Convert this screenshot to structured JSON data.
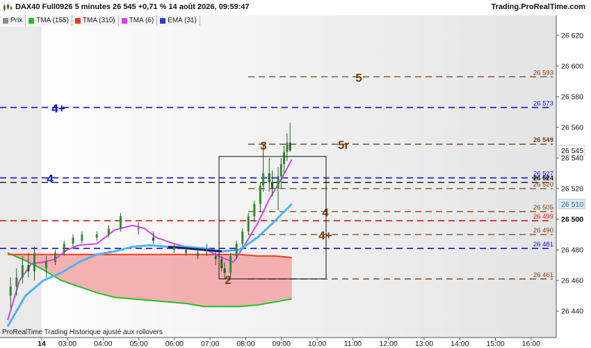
{
  "header": {
    "title": "DAX40 Full0926 5 minutes 26 545 +0,71 % 14 août 2026, 09:59:47",
    "brand": "Trading.ProRealTime.com"
  },
  "legend": [
    {
      "label": "Prix",
      "color": "#8e8e8e"
    },
    {
      "label": "TMA (155)",
      "color": "#22c022"
    },
    {
      "label": "TMA (310)",
      "color": "#ee3a1e"
    },
    {
      "label": "TMA (6)",
      "color": "#cc44ee"
    },
    {
      "label": "EMA (31)",
      "color": "#2244cc"
    }
  ],
  "footer": {
    "note": "ProRealTime Trading  Historique ajusté aux rollovers"
  },
  "chart_data": {
    "type": "line",
    "title": "DAX40 Full0926 5 minutes",
    "x_ticks": [
      "14",
      "03:00",
      "04:00",
      "05:00",
      "06:00",
      "07:00",
      "08:00",
      "09:00",
      "10:00",
      "11:00",
      "12:00",
      "13:00",
      "14:00",
      "15:00",
      "16:00"
    ],
    "y_ticks": [
      26440,
      26460,
      26480,
      26500,
      26520,
      26540,
      26560,
      26580,
      26600,
      26620
    ],
    "y_tick_labels": [
      "26 440",
      "26 460",
      "26 480",
      "26 500",
      "26 520",
      "26 540",
      "26 560",
      "26 580",
      "26 600",
      "26 620"
    ],
    "ylim": [
      26430,
      26627
    ],
    "xlim": [
      "02:00",
      "16:35"
    ],
    "grid": false,
    "levels": [
      {
        "value": 26593,
        "label": "26 593",
        "tag": "5",
        "color": "#7a3e0e"
      },
      {
        "value": 26573,
        "label": "26 573",
        "tag": "4+",
        "color": "#0f0fd0"
      },
      {
        "value": 26549,
        "label": "26 549",
        "tag": "5r",
        "color": "#7a3e0e"
      },
      {
        "value": 26527,
        "label": "26 527",
        "tag": "4",
        "color": "#0f0fd0"
      },
      {
        "value": 26524,
        "label": "26 524",
        "tag": "",
        "color": "#111111"
      },
      {
        "value": 26520,
        "label": "26 520",
        "tag": "",
        "color": "#7a3e0e"
      },
      {
        "value": 26505,
        "label": "26 505",
        "tag": "4",
        "color": "#7a3e0e"
      },
      {
        "value": 26499,
        "label": "26 499",
        "tag": "",
        "color": "#e01010"
      },
      {
        "value": 26490,
        "label": "26 490",
        "tag": "4+",
        "color": "#7a3e0e"
      },
      {
        "value": 26481,
        "label": "26 481",
        "tag": "",
        "color": "#0f0fd0"
      },
      {
        "value": 26461,
        "label": "26 461",
        "tag": "2",
        "color": "#7a3e0e"
      }
    ],
    "box_label_3": "3",
    "last_price": {
      "value": 26545,
      "label": "26 545"
    },
    "ema_last": {
      "value": 26510,
      "label": "26 510"
    },
    "bold_tick": {
      "value": 26500,
      "label": "26 500"
    },
    "series": [
      {
        "name": "TMA (155)",
        "color": "#22c022",
        "points": [
          [
            "02:00",
            26478
          ],
          [
            "02:30",
            26473
          ],
          [
            "03:00",
            26467
          ],
          [
            "03:30",
            26460
          ],
          [
            "04:00",
            26456
          ],
          [
            "04:30",
            26452
          ],
          [
            "05:00",
            26449
          ],
          [
            "05:30",
            26448
          ],
          [
            "06:00",
            26447
          ],
          [
            "06:30",
            26446
          ],
          [
            "07:00",
            26445
          ],
          [
            "07:30",
            26443
          ],
          [
            "08:00",
            26443
          ],
          [
            "08:30",
            26443
          ],
          [
            "09:00",
            26444
          ],
          [
            "09:30",
            26446
          ],
          [
            "09:58",
            26448
          ]
        ]
      },
      {
        "name": "TMA (310)",
        "color": "#ee3a1e",
        "points": [
          [
            "02:00",
            26477
          ],
          [
            "03:00",
            26477
          ],
          [
            "04:00",
            26477
          ],
          [
            "05:00",
            26477
          ],
          [
            "06:00",
            26477
          ],
          [
            "07:00",
            26477
          ],
          [
            "07:30",
            26477
          ],
          [
            "08:00",
            26477
          ],
          [
            "08:30",
            26477
          ],
          [
            "09:00",
            26476
          ],
          [
            "09:30",
            26476
          ],
          [
            "09:58",
            26475
          ]
        ]
      },
      {
        "name": "TMA (6)",
        "color": "#cc44ee",
        "points": [
          [
            "02:00",
            26434
          ],
          [
            "02:20",
            26460
          ],
          [
            "02:40",
            26471
          ],
          [
            "03:00",
            26472
          ],
          [
            "03:20",
            26474
          ],
          [
            "03:40",
            26480
          ],
          [
            "04:00",
            26483
          ],
          [
            "04:30",
            26484
          ],
          [
            "05:00",
            26493
          ],
          [
            "05:30",
            26496
          ],
          [
            "05:50",
            26494
          ],
          [
            "06:10",
            26488
          ],
          [
            "06:40",
            26484
          ],
          [
            "07:00",
            26482
          ],
          [
            "07:20",
            26481
          ],
          [
            "07:40",
            26479
          ],
          [
            "08:00",
            26475
          ],
          [
            "08:20",
            26472
          ],
          [
            "08:40",
            26484
          ],
          [
            "09:00",
            26497
          ],
          [
            "09:20",
            26513
          ],
          [
            "09:40",
            26526
          ],
          [
            "09:58",
            26539
          ]
        ]
      },
      {
        "name": "EMA (31)",
        "color": "#4fb3f0",
        "points": [
          [
            "02:00",
            26430
          ],
          [
            "02:30",
            26450
          ],
          [
            "03:00",
            26460
          ],
          [
            "03:30",
            26465
          ],
          [
            "04:00",
            26472
          ],
          [
            "04:30",
            26477
          ],
          [
            "05:00",
            26479
          ],
          [
            "05:30",
            26482
          ],
          [
            "06:00",
            26483
          ],
          [
            "06:30",
            26482
          ],
          [
            "07:00",
            26482
          ],
          [
            "07:30",
            26481
          ],
          [
            "08:00",
            26479
          ],
          [
            "08:30",
            26480
          ],
          [
            "09:00",
            26488
          ],
          [
            "09:30",
            26499
          ],
          [
            "09:58",
            26510
          ]
        ]
      }
    ],
    "candles": [
      [
        "02:05",
        26450,
        26462,
        26442,
        26456
      ],
      [
        "02:15",
        26456,
        26468,
        26450,
        26462
      ],
      [
        "02:25",
        26462,
        26476,
        26458,
        26470
      ],
      [
        "02:35",
        26470,
        26478,
        26462,
        26466
      ],
      [
        "02:45",
        26466,
        26482,
        26460,
        26478
      ],
      [
        "03:05",
        26468,
        26476,
        26462,
        26472
      ],
      [
        "03:20",
        26472,
        26480,
        26470,
        26478
      ],
      [
        "03:35",
        26478,
        26486,
        26476,
        26484
      ],
      [
        "03:50",
        26484,
        26490,
        26482,
        26488
      ],
      [
        "04:05",
        26486,
        26492,
        26484,
        26490
      ],
      [
        "04:30",
        26488,
        26492,
        26486,
        26490
      ],
      [
        "04:50",
        26490,
        26496,
        26488,
        26494
      ],
      [
        "05:10",
        26494,
        26504,
        26492,
        26502
      ],
      [
        "05:40",
        26494,
        26498,
        26490,
        26494
      ],
      [
        "06:05",
        26488,
        26492,
        26484,
        26486
      ],
      [
        "06:40",
        26480,
        26484,
        26478,
        26482
      ],
      [
        "07:00",
        26478,
        26482,
        26476,
        26480
      ],
      [
        "07:20",
        26476,
        26480,
        26474,
        26478
      ],
      [
        "07:35",
        26480,
        26484,
        26476,
        26480
      ],
      [
        "07:50",
        26476,
        26480,
        26470,
        26474
      ],
      [
        "08:00",
        26474,
        26476,
        26466,
        26468
      ],
      [
        "08:05",
        26468,
        26472,
        26461,
        26465
      ],
      [
        "08:15",
        26465,
        26478,
        26462,
        26476
      ],
      [
        "08:25",
        26476,
        26486,
        26474,
        26484
      ],
      [
        "08:35",
        26484,
        26494,
        26482,
        26492
      ],
      [
        "08:45",
        26492,
        26504,
        26490,
        26502
      ],
      [
        "08:55",
        26502,
        26512,
        26498,
        26510
      ],
      [
        "09:05",
        26510,
        26524,
        26505,
        26522
      ],
      [
        "09:10",
        26522,
        26548,
        26518,
        26530
      ],
      [
        "09:20",
        26530,
        26540,
        26518,
        26524
      ],
      [
        "09:25",
        26524,
        26532,
        26515,
        26520
      ],
      [
        "09:35",
        26520,
        26534,
        26506,
        26528
      ],
      [
        "09:40",
        26528,
        26540,
        26520,
        26536
      ],
      [
        "09:45",
        26536,
        26548,
        26530,
        26544
      ],
      [
        "09:50",
        26544,
        26556,
        26538,
        26550
      ],
      [
        "09:55",
        26550,
        26563,
        26544,
        26545
      ]
    ]
  }
}
